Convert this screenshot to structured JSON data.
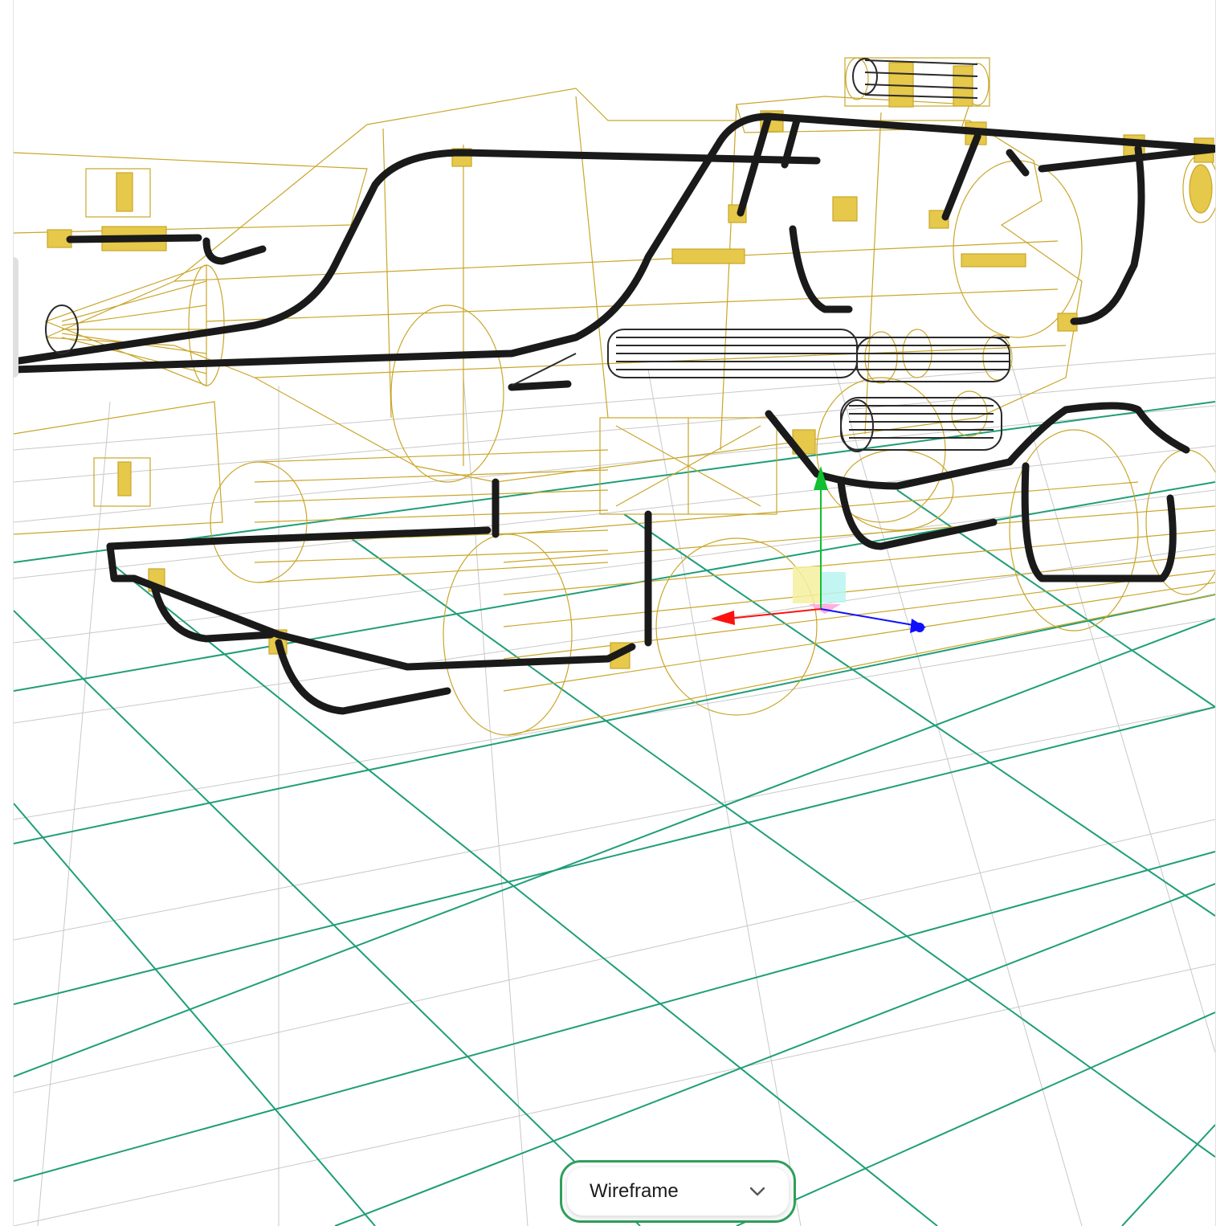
{
  "viewer": {
    "render_mode": {
      "label": "Wireframe",
      "icon": "chevron-down-icon"
    },
    "colors": {
      "grid_major": "#1f9e78",
      "grid_minor": "#c8c8c8",
      "wire_gold": "#c9a62a",
      "wire_dark": "#1a1a1a",
      "axis_x": "#ff1010",
      "axis_y": "#10c030",
      "axis_z": "#1010ff",
      "focus_ring": "#2ea05a"
    }
  }
}
